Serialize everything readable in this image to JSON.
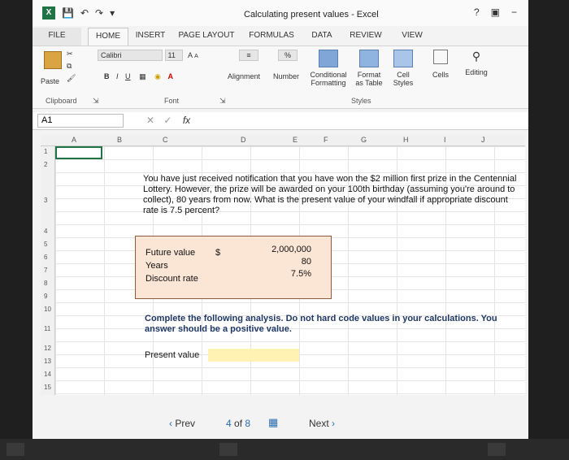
{
  "window": {
    "title": "Calculating present values - Excel",
    "help": "?",
    "minimize": "−"
  },
  "tabs": [
    "FILE",
    "HOME",
    "INSERT",
    "PAGE LAYOUT",
    "FORMULAS",
    "DATA",
    "REVIEW",
    "VIEW"
  ],
  "ribbon": {
    "paste": "Paste",
    "font_name": "Calibri",
    "font_size": "11",
    "grow": "A",
    "shrink": "A",
    "bold": "B",
    "italic": "I",
    "underline": "U",
    "alignment": "Alignment",
    "number": "Number",
    "percent": "%",
    "conditional": "Conditional Formatting",
    "format_table": "Format as Table",
    "cell_styles": "Cell Styles",
    "cells": "Cells",
    "editing": "Editing",
    "groups": {
      "clipboard": "Clipboard",
      "font": "Font",
      "styles": "Styles"
    }
  },
  "formula_bar": {
    "name_box": "A1",
    "fx": "fx"
  },
  "columns": [
    "A",
    "B",
    "C",
    "D",
    "E",
    "F",
    "G",
    "H",
    "I",
    "J"
  ],
  "rows": [
    "1",
    "2",
    "3",
    "4",
    "5",
    "6",
    "7",
    "8",
    "9",
    "10",
    "11",
    "12",
    "13",
    "14",
    "15"
  ],
  "question": "You have just received notification that you have won the $2 million first prize in the Centennial Lottery. However, the prize will be awarded on your 100th birthday (assuming you're around to collect), 80 years from now. What is the present value of your windfall if appropriate discount rate is 7.5 percent?",
  "inputs": {
    "future_value_label": "Future value",
    "future_value_symbol": "$",
    "future_value": "2,000,000",
    "years_label": "Years",
    "years": "80",
    "rate_label": "Discount rate",
    "rate": "7.5%"
  },
  "instruction": "Complete the following analysis. Do not hard code values in your calculations. You answer should be a positive value.",
  "present_value_label": "Present value",
  "present_value": "",
  "pager": {
    "prev": "Prev",
    "page": "4",
    "of": "of",
    "total": "8",
    "next": "Next"
  }
}
